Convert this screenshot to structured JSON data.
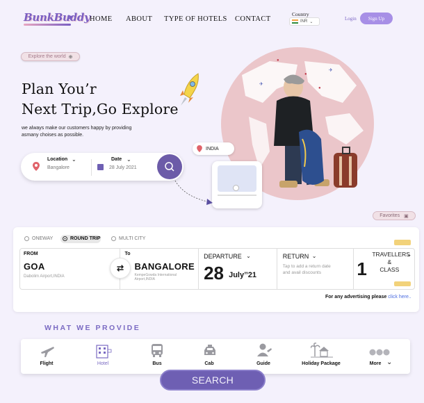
{
  "brand": {
    "logo_text": "BunkBuddy"
  },
  "nav": {
    "home": "HOME",
    "about": "ABOUT",
    "types": "TYPE OF HOTELS",
    "contact": "CONTACT"
  },
  "country": {
    "label": "Country",
    "currency": "INR"
  },
  "auth": {
    "login": "Login",
    "signup": "Sign Up"
  },
  "hero": {
    "explore_pill": "Explore the world",
    "title_line1": "Plan You’r",
    "title_line2": "Next Trip,Go Explore",
    "subtitle_line1": "we always make our customers  happy by providing",
    "subtitle_line2": "asmany choises as possible."
  },
  "search": {
    "location_label": "Location",
    "location_value": "Bangalore",
    "date_label": "Date",
    "date_value": "28 July 2021"
  },
  "preview": {
    "place": "INDIA"
  },
  "favorites": "Favorites",
  "booking": {
    "trip_types": [
      "ONEWAY",
      "ROUND TRIP",
      "MULTI CITY"
    ],
    "from_label": "FROM",
    "from_city": "GOA",
    "from_airport": "Dabolim Airport,INDIA",
    "to_label": "To",
    "to_city": "BANGALORE",
    "to_airport_line1": "KempeGowda International",
    "to_airport_line2": "Airport,INDIA",
    "departure_label": "DEPARTURE",
    "departure_day": "28",
    "departure_month": "July’’21",
    "return_label": "RETURN",
    "return_hint_line1": "Tap to add a return date",
    "return_hint_line2": "and avail discounts",
    "travellers_count": "1",
    "travellers_label_line1": "TRAVELLERS",
    "travellers_label_line2": "&",
    "travellers_label_line3": "CLASS",
    "ad_text": "For any advertising please ",
    "ad_link": "click here.."
  },
  "provide": {
    "title": "WHAT WE PROVIDE",
    "items": [
      "Flight",
      "Hotel",
      "Bus",
      "Cab",
      "Guide",
      "Holiday Package",
      "More"
    ]
  },
  "search_button": "SEARCH",
  "colors": {
    "accent": "#6e5fb3",
    "globe": "#ebc6ca",
    "link": "#4a6be0"
  }
}
